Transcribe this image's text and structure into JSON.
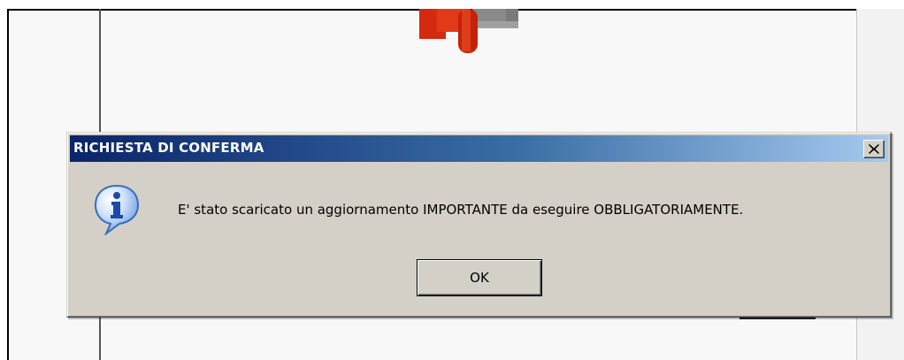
{
  "dialog": {
    "title": "RICHIESTA DI CONFERMA",
    "close_icon": "close-icon",
    "icon": "info-icon",
    "message": "E' stato scaricato un aggiornamento IMPORTANTE da eseguire OBBLIGATORIAMENTE.",
    "ok_label": "OK",
    "titlebar_colors": [
      "#0a246a",
      "#a6caf0"
    ],
    "face_color": "#d4d0c8"
  },
  "background": {
    "logo_icon": "app-logo-icon",
    "logo_colors": [
      "#e03010",
      "#888888"
    ]
  }
}
